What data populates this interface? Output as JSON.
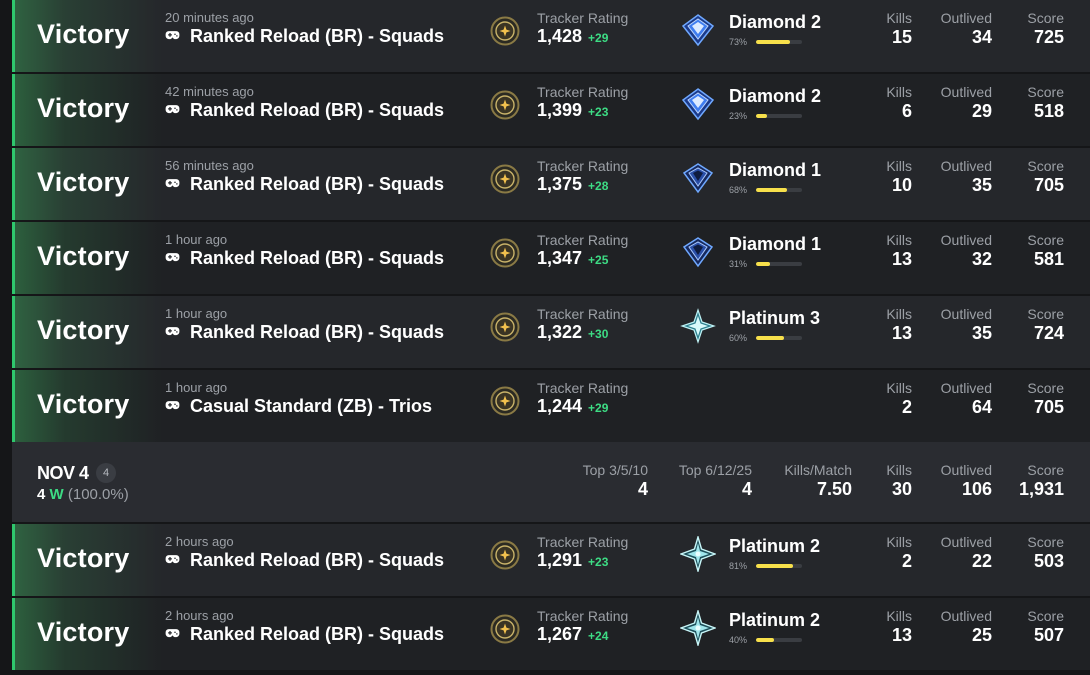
{
  "labels": {
    "tracker_rating": "Tracker Rating",
    "kills": "Kills",
    "outlived": "Outlived",
    "score": "Score"
  },
  "icons": {
    "tracker": "tracker-rating-icon",
    "controller": "gamepad-icon",
    "diamond": "diamond-rank-icon",
    "platinum": "platinum-rank-icon"
  },
  "colors": {
    "win_accent": "#2fc76d",
    "delta_green": "#3ddc84",
    "progress_yellow": "#f7e04b",
    "row_bg": "#25272b",
    "row_bg_alt": "#1f2124"
  },
  "matches_today": [
    {
      "result": "Victory",
      "time": "20 minutes ago",
      "mode": "Ranked Reload (BR) - Squads",
      "rating": "1,428",
      "delta": "+29",
      "rank": "Diamond 2",
      "rank_type": "diamond",
      "progress": "73%",
      "progress_value": 0.73,
      "kills": "15",
      "outlived": "34",
      "score": "725"
    },
    {
      "result": "Victory",
      "time": "42 minutes ago",
      "mode": "Ranked Reload (BR) - Squads",
      "rating": "1,399",
      "delta": "+23",
      "rank": "Diamond 2",
      "rank_type": "diamond",
      "progress": "23%",
      "progress_value": 0.23,
      "kills": "6",
      "outlived": "29",
      "score": "518"
    },
    {
      "result": "Victory",
      "time": "56 minutes ago",
      "mode": "Ranked Reload (BR) - Squads",
      "rating": "1,375",
      "delta": "+28",
      "rank": "Diamond 1",
      "rank_type": "diamond1",
      "progress": "68%",
      "progress_value": 0.68,
      "kills": "10",
      "outlived": "35",
      "score": "705"
    },
    {
      "result": "Victory",
      "time": "1 hour ago",
      "mode": "Ranked Reload (BR) - Squads",
      "rating": "1,347",
      "delta": "+25",
      "rank": "Diamond 1",
      "rank_type": "diamond1",
      "progress": "31%",
      "progress_value": 0.31,
      "kills": "13",
      "outlived": "32",
      "score": "581"
    },
    {
      "result": "Victory",
      "time": "1 hour ago",
      "mode": "Ranked Reload (BR) - Squads",
      "rating": "1,322",
      "delta": "+30",
      "rank": "Platinum 3",
      "rank_type": "platinum",
      "progress": "60%",
      "progress_value": 0.6,
      "kills": "13",
      "outlived": "35",
      "score": "724"
    },
    {
      "result": "Victory",
      "time": "1 hour ago",
      "mode": "Casual Standard (ZB) - Trios",
      "rating": "1,244",
      "delta": "+29",
      "rank": "",
      "rank_type": "",
      "progress": "",
      "progress_value": null,
      "kills": "2",
      "outlived": "64",
      "score": "705"
    }
  ],
  "summary": {
    "date": "NOV 4",
    "count": "4",
    "wins_count": "4",
    "wins_letter": "W",
    "win_pct": "(100.0%)",
    "top10_label": "Top 3/5/10",
    "top10": "4",
    "top25_label": "Top 6/12/25",
    "top25": "4",
    "kpm_label": "Kills/Match",
    "kpm": "7.50",
    "kills_label": "Kills",
    "kills": "30",
    "outlived_label": "Outlived",
    "outlived": "106",
    "score_label": "Score",
    "score": "1,931"
  },
  "matches_nov4": [
    {
      "result": "Victory",
      "time": "2 hours ago",
      "mode": "Ranked Reload (BR) - Squads",
      "rating": "1,291",
      "delta": "+23",
      "rank": "Platinum 2",
      "rank_type": "platinum2",
      "progress": "81%",
      "progress_value": 0.81,
      "kills": "2",
      "outlived": "22",
      "score": "503"
    },
    {
      "result": "Victory",
      "time": "2 hours ago",
      "mode": "Ranked Reload (BR) - Squads",
      "rating": "1,267",
      "delta": "+24",
      "rank": "Platinum 2",
      "rank_type": "platinum2",
      "progress": "40%",
      "progress_value": 0.4,
      "kills": "13",
      "outlived": "25",
      "score": "507"
    }
  ]
}
